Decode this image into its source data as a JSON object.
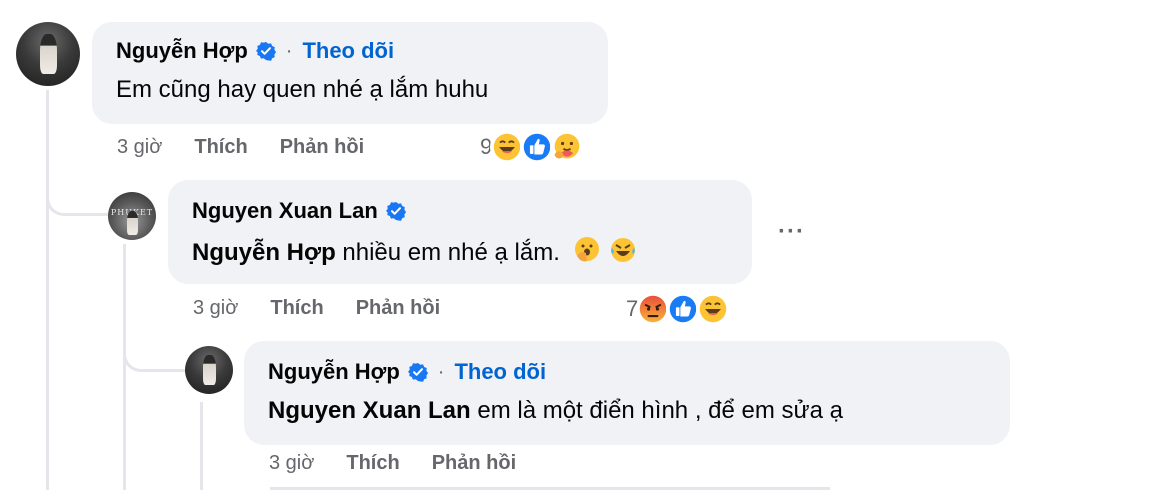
{
  "comments": [
    {
      "author": "Nguyễn Hợp",
      "follow_label": "Theo dõi",
      "separator": "·",
      "text": "Em cũng hay quen nhé ạ lắm huhu",
      "time": "3 giờ",
      "like_label": "Thích",
      "reply_label": "Phản hồi",
      "reaction_count": "9",
      "reactions": [
        "laughing-emoji",
        "like-emoji",
        "care-emoji"
      ]
    },
    {
      "author": "Nguyen Xuan Lan",
      "avatar_text": "PHUKET",
      "mention": "Nguyễn Hợp",
      "text": "nhiều em nhé ạ lắm.",
      "text_emojis": [
        "hand-over-mouth-emoji",
        "rolling-laughing-emoji"
      ],
      "more_label": "···",
      "time": "3 giờ",
      "like_label": "Thích",
      "reply_label": "Phản hồi",
      "reaction_count": "7",
      "reactions": [
        "angry-emoji",
        "like-emoji",
        "laughing-emoji"
      ]
    },
    {
      "author": "Nguyễn Hợp",
      "follow_label": "Theo dõi",
      "separator": "·",
      "mention": "Nguyen Xuan Lan",
      "text": "em là một điển hình , để em sửa ạ",
      "time": "3 giờ",
      "like_label": "Thích",
      "reply_label": "Phản hồi"
    }
  ],
  "colors": {
    "bubble": "#f0f2f5",
    "link": "#0064d1",
    "meta": "#65676b",
    "verified": "#1877f2"
  }
}
